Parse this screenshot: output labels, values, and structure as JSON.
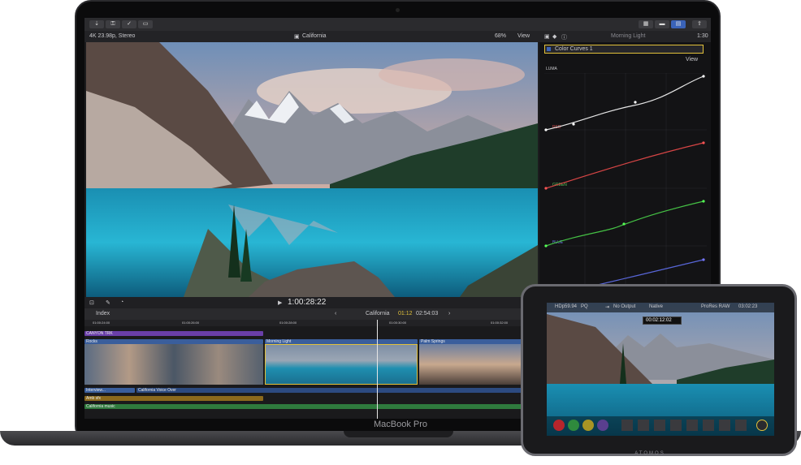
{
  "laptop": {
    "brand": "MacBook Pro"
  },
  "fcp": {
    "viewer_format": "4K 23.98p, Stereo",
    "project_title": "California",
    "zoom": "68%",
    "view_label": "View",
    "inspector_clip": "Morning Light",
    "inspector_duration": "1:30",
    "effect_name": "Color Curves 1",
    "inspector_view": "View",
    "curve_luma": "LUMA",
    "curve_red": "RED",
    "curve_green": "GREEN",
    "curve_blue": "BLUE",
    "timecode": "1:00:28:22",
    "index_label": "Index",
    "timeline_project": "California",
    "timeline_position": "01:12",
    "timeline_duration": "02:54:03",
    "ruler": [
      "01:00:24:00",
      "01:00:26:00",
      "01:00:28:00",
      "01:00:30:00",
      "01:00:32:00"
    ],
    "clips": {
      "canyon": "CANYON TRK",
      "rocks": "Rocks",
      "morning": "Morning Light",
      "palm": "Palm Springs",
      "interview": "Interview...",
      "voice": "California Voice Over",
      "amb": "Amb sfx",
      "music": "California music"
    }
  },
  "atomos": {
    "format": "HDp59.94",
    "codec_short": "PQ",
    "output": "No Output",
    "native": "Native",
    "record_codec": "ProRes RAW",
    "record_time": "03:02:23",
    "timecode": "00:02:12:02",
    "brand": "ATOMOS"
  },
  "colors": {
    "accent_yellow": "#e2c13a",
    "purple_clip": "#6a3fa8",
    "blue_clip": "#3a5e9c",
    "green_clip": "#2f7a3d",
    "amber_clip": "#8c6a1d"
  }
}
